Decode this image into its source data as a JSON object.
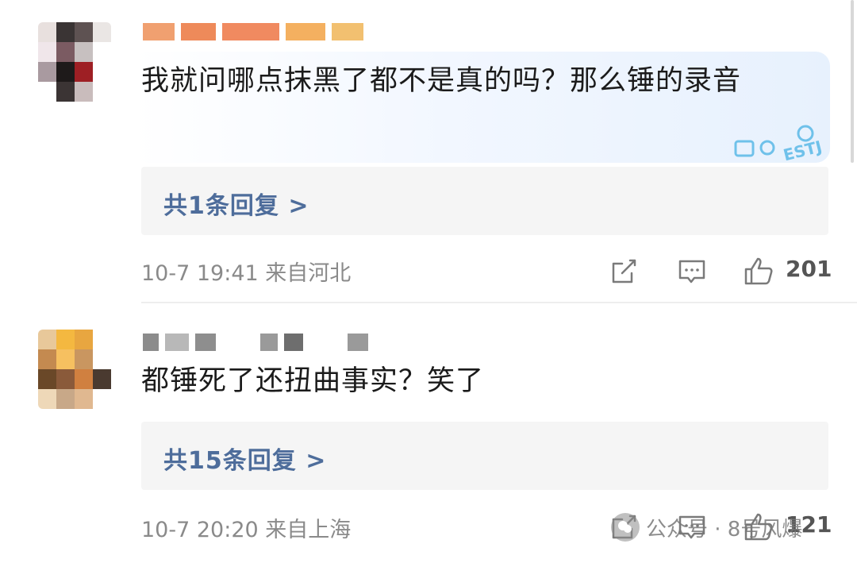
{
  "comments": [
    {
      "text": "我就问哪点抹黑了都不是真的吗？那么锤的录音",
      "replies_label": "共1条回复 >",
      "meta": "10-7 19:41 来自河北",
      "likes": "201",
      "sticker_text": "ESTJ"
    },
    {
      "text": "都锤死了还扭曲事实？笑了",
      "replies_label": "共15条回复 >",
      "meta": "10-7 20:20 来自上海",
      "likes": "121"
    }
  ],
  "watermark": {
    "text": "公众号 · 8号风爆"
  },
  "colors": {
    "reply_link": "#4e6d9b",
    "meta_gray": "#8a8a8a",
    "bubble_blue": "#e7f1fd"
  },
  "icons": [
    "share-icon",
    "comment-icon",
    "like-icon"
  ]
}
